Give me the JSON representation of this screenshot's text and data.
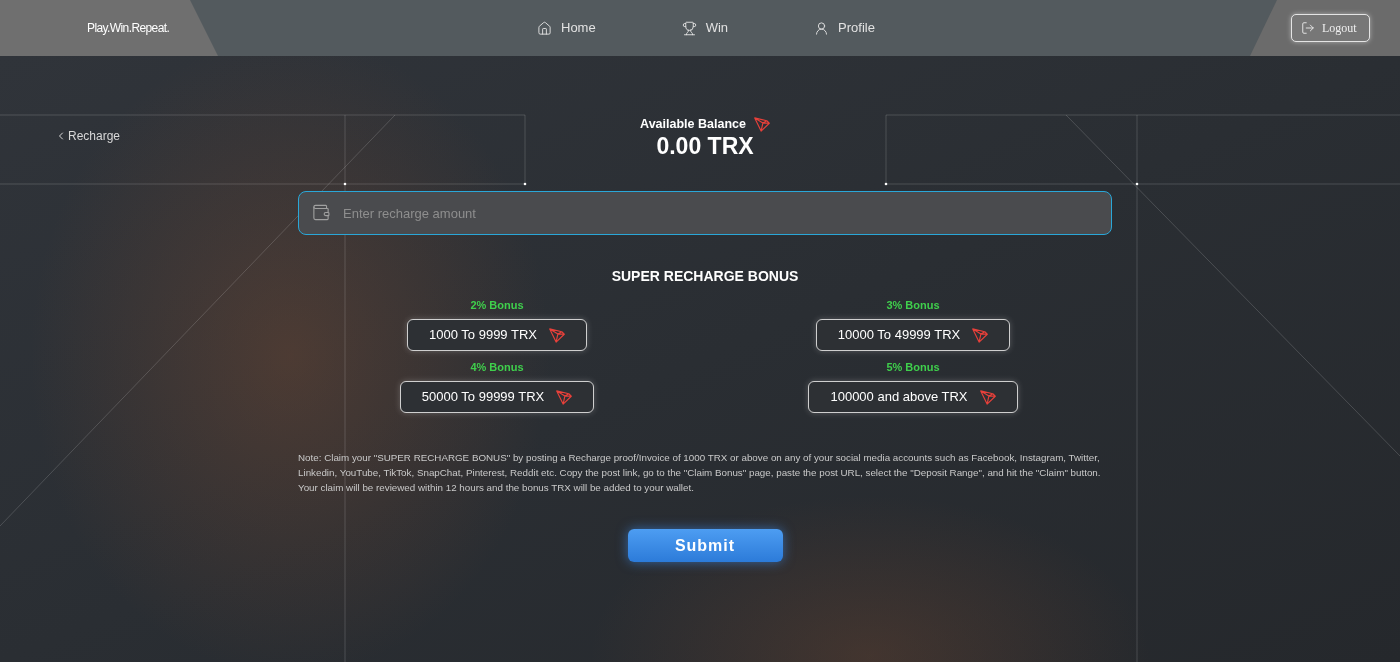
{
  "header": {
    "brand": "Play.Win.Repeat.",
    "nav": [
      {
        "label": "Home",
        "kind": "home"
      },
      {
        "label": "Win",
        "kind": "trophy"
      },
      {
        "label": "Profile",
        "kind": "user"
      }
    ],
    "logout_button": "Logout"
  },
  "back_link": "Recharge",
  "balance": {
    "label": "Available Balance",
    "amount": "0.00 TRX"
  },
  "recharge_field": {
    "placeholder": "Enter recharge amount"
  },
  "bonus": {
    "title": "SUPER RECHARGE BONUS",
    "tiers": [
      {
        "bonus": "2% Bonus",
        "range": "1000 To 9999 TRX"
      },
      {
        "bonus": "3% Bonus",
        "range": "10000 To 49999 TRX"
      },
      {
        "bonus": "4% Bonus",
        "range": "50000 To 99999 TRX"
      },
      {
        "bonus": "5% Bonus",
        "range": "100000 and above TRX"
      }
    ]
  },
  "note": "Note: Claim your \"SUPER RECHARGE BONUS\" by posting a Recharge proof/Invoice of 1000 TRX or above on any of your social media accounts such as Facebook, Instagram, Twitter, Linkedin, YouTube, TikTok, SnapChat, Pinterest, Reddit etc. Copy the post link, go to the \"Claim Bonus\" page, paste the post URL, select the \"Deposit Range\", and hit the \"Claim\" button. Your claim will be reviewed within 12 hours and the bonus TRX will be added to your wallet.",
  "submit_button": "Submit"
}
